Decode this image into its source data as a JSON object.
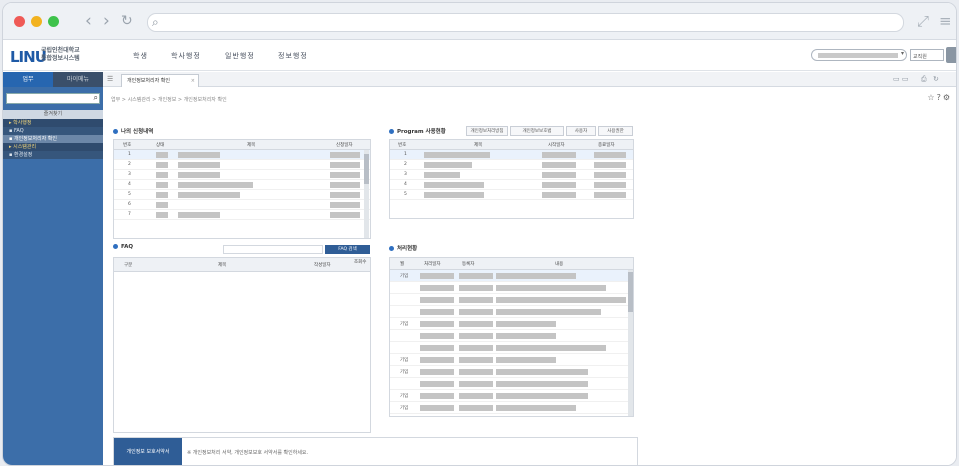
{
  "browser": {
    "address": ""
  },
  "app": {
    "logo_mark": "LINU",
    "logo_text_1": "국립인천대학교",
    "logo_text_2": "통합정보시스템",
    "menu": [
      "학생",
      "학사행정",
      "일반행정",
      "정보행정"
    ],
    "user_select": "",
    "role_select": "교직원"
  },
  "sidebar": {
    "tabs": [
      "업무",
      "마이메뉴"
    ],
    "search_placeholder": "",
    "group_label": "즐겨찾기",
    "items": [
      {
        "label": "▸ 학사행정",
        "kind": "group"
      },
      {
        "label": "▪ FAQ",
        "kind": "sub"
      },
      {
        "label": "▪ 개인정보처리자 확인",
        "kind": "sel"
      },
      {
        "label": "▸ 시스템관리",
        "kind": "group"
      },
      {
        "label": "▪ 환경설정",
        "kind": "sub"
      }
    ]
  },
  "main": {
    "tab_label": "개인정보처리자 확인",
    "breadcrumb": "업무 > 시스템관리 > 개인정보 > 개인정보처리자 확인",
    "panel_notice": {
      "title": "나의 신청내역",
      "headers": [
        "번호",
        "상태",
        "제목",
        "신청일자"
      ],
      "rows": [
        "1",
        "2",
        "3",
        "4",
        "5",
        "6",
        "7"
      ]
    },
    "panel_faq": {
      "title": "FAQ",
      "button": "FAQ 검색",
      "headers": [
        "구분",
        "제목",
        "작성일자",
        "조회수"
      ]
    },
    "panel_program": {
      "title": "Program 사용현황",
      "buttons": [
        "개인정보처리방침",
        "개인정보보호법",
        "사용자",
        "사용권한"
      ],
      "headers": [
        "번호",
        "제목",
        "시작일자",
        "종료일자"
      ],
      "rows": [
        "1",
        "2",
        "3",
        "4",
        "5"
      ]
    },
    "panel_status": {
      "title": "처리현황",
      "headers": [
        "월",
        "처리일자",
        "등록자",
        "내용"
      ],
      "rows": [
        "기입",
        "",
        "",
        "",
        "기입",
        "",
        "",
        "기입",
        "기입",
        "",
        "기입",
        "기입"
      ]
    },
    "bottom_button": "개인정보 보호서약서",
    "bottom_text": "※ 개인정보처리 서약, 개인정보보호 서약서를 확인하세요."
  },
  "colors": {
    "accent": "#2f5d96",
    "sidebar": "#3c6ea9",
    "highlight": "#e8a733"
  }
}
